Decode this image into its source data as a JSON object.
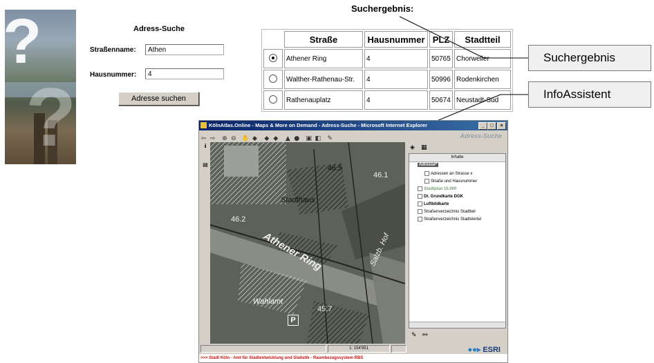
{
  "search": {
    "title": "Adress-Suche",
    "street_label": "Straßenname:",
    "street_value": "Athen",
    "number_label": "Hausnummer:",
    "number_value": "4",
    "button_label": "Adresse suchen"
  },
  "results": {
    "title": "Suchergebnis:",
    "columns": [
      "Straße",
      "Hausnummer",
      "PLZ",
      "Stadtteil"
    ],
    "rows": [
      {
        "selected": true,
        "street": "Athener Ring",
        "number": "4",
        "plz": "50765",
        "district": "Chorweiler"
      },
      {
        "selected": false,
        "street": "Walther-Rathenau-Str.",
        "number": "4",
        "plz": "50996",
        "district": "Rodenkirchen"
      },
      {
        "selected": false,
        "street": "Rathenauplatz",
        "number": "4",
        "plz": "50674",
        "district": "Neustadt-Süd"
      }
    ]
  },
  "callouts": {
    "result": "Suchergebnis",
    "info": "InfoAssistent"
  },
  "window": {
    "title": "KölnAtlas.Online - Maps & More on Demand - Adress-Suche - Microsoft Internet Explorer",
    "app_name": "Adress-Suche",
    "panel_header": "Inhalte",
    "tree": [
      {
        "label": "Adresse*",
        "style": "sel"
      },
      {
        "label": "Adressen an Strasse x",
        "style": "normal"
      },
      {
        "label": "Straße und Hausnummer",
        "style": "normal"
      },
      {
        "label": "Stadtplan 15.000",
        "style": "green"
      },
      {
        "label": "Dt. Grundkarte DGK",
        "style": "bold"
      },
      {
        "label": "Luftbildkarte",
        "style": "bold"
      },
      {
        "label": "Straßenverzeichnis Stadtteil",
        "style": "normal"
      },
      {
        "label": "Straßenverzeichnis Stadtviertel",
        "style": "normal"
      }
    ],
    "map_labels": {
      "stadthaus": "Stadthaus",
      "athener_ring": "Athener Ring",
      "salzb_hof": "Salzb. Hof",
      "wahlamt": "Wahlamt",
      "parking": "P",
      "height_1": "46.5",
      "height_2": "46.2",
      "height_3": "45.7",
      "height_4": "46.1"
    },
    "scale": "1: 154'951",
    "esri": "ESRI",
    "footer": ">>> Stadt Köln - Amt für Stadtentwicklung und Statistik - Raumbezugssystem RBS"
  },
  "colors": {
    "titlebar": "#0a246a",
    "footer_text": "#d01010",
    "window_bg": "#d4d0c8"
  }
}
